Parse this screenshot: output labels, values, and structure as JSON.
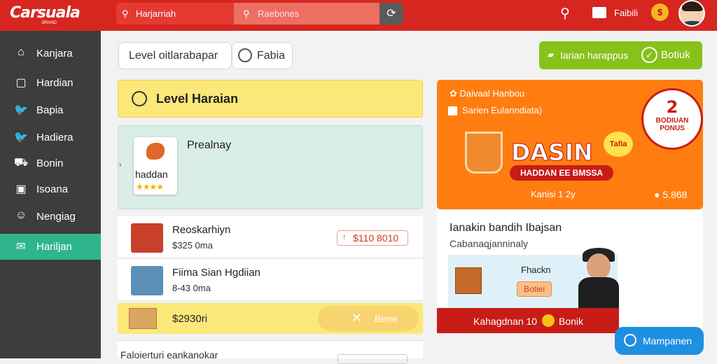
{
  "header": {
    "logo": "Carsuala",
    "logo_sub": "BRAND",
    "search_primary": "Harjarriah",
    "search_secondary": "Raebones",
    "folder_label": "Faibili"
  },
  "sidebar": {
    "items": [
      {
        "label": "Kanjara",
        "icon": "home-icon"
      },
      {
        "label": "Hardian",
        "icon": "square-icon"
      },
      {
        "label": "Bapia",
        "icon": "bird-icon"
      },
      {
        "label": "Hadiera",
        "icon": "bird-icon"
      },
      {
        "label": "Bonin",
        "icon": "car-icon"
      },
      {
        "label": "Isoana",
        "icon": "bag-icon"
      },
      {
        "label": "Nengiag",
        "icon": "chef-icon"
      },
      {
        "label": "Hariljan",
        "icon": "mail-icon"
      }
    ],
    "active_index": 7
  },
  "filters": {
    "pill_label": "Level oitlarabapar",
    "radio_label": "Fabia",
    "green_button_label": "Iarian harappus",
    "green_button_action": "Botiuk"
  },
  "level": {
    "title": "Level Haraian"
  },
  "featured": {
    "title": "Prealnay",
    "app_name": "haddan",
    "stars": "★★★★"
  },
  "rows": [
    {
      "name": "Reoskarhiyn",
      "sub": "$325 0ma",
      "price": "$110 8010"
    },
    {
      "name": "Fiima Sian Hgdiian",
      "sub": "8-43 0ma"
    }
  ],
  "yellow_row": {
    "amount": "$2930ri",
    "button_label": "Bene"
  },
  "bottom_row": {
    "text": "Faloierturi eankanokar"
  },
  "promo": {
    "line1": "Daivaal Hanbou",
    "line2": "Sarien Eulanndiata)",
    "headline": "DASIN",
    "bar_text": "HADDAN EE BMSSA",
    "small_text": "Kanisi 1 2y",
    "amount": "5.868",
    "badge_big": "2",
    "badge_small": "BODIUAN PONUS",
    "star_text": "Tafia"
  },
  "panel": {
    "title": "Ianakin bandih Ibajsan",
    "subtitle": "Cabanaqjanninaly",
    "image_label": "Fhackn",
    "image_button": "Botiei",
    "footer_left": "Kahagdnan 10",
    "footer_right": "Bonik"
  },
  "floating": {
    "label": "Mampanen"
  },
  "colors": {
    "brand_red": "#d7261f",
    "sidebar_bg": "#3d3d3d",
    "active_green": "#2fb58c",
    "accent_green": "#86c21a",
    "promo_orange": "#ff7d10",
    "float_blue": "#1f8fe0"
  }
}
